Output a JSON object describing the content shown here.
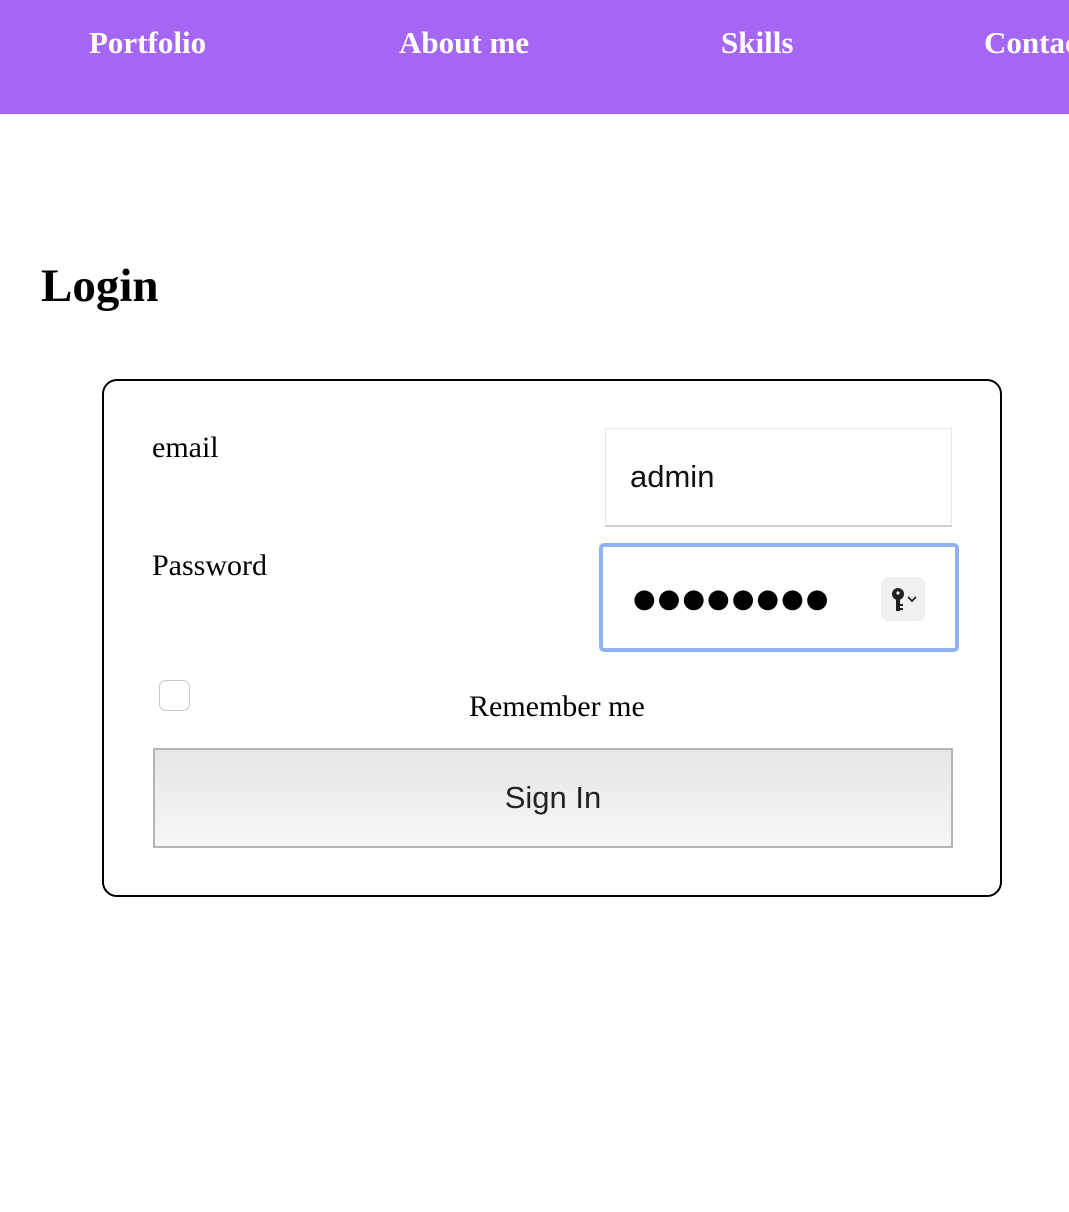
{
  "nav": {
    "items": [
      "Portfolio",
      "About me",
      "Skills",
      "Contact"
    ],
    "background_color": "#a567f3"
  },
  "page": {
    "title": "Login"
  },
  "form": {
    "email_label": "email",
    "email_value": "admin",
    "password_label": "Password",
    "password_masked": "●●●●●●●●",
    "password_length": 8,
    "password_focused": true,
    "password_key_icon": "key-icon",
    "remember_label": "Remember me",
    "remember_checked": false,
    "submit_label": "Sign In",
    "focus_ring_color": "#8fb3ee"
  }
}
